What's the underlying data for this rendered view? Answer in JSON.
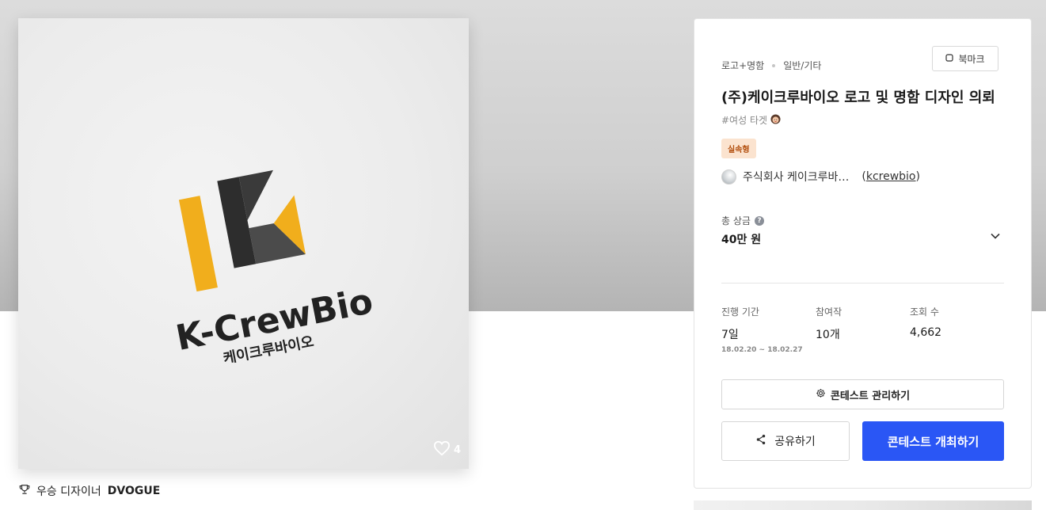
{
  "artwork": {
    "brand_name": "K-CrewBio",
    "brand_name_ko": "케이크루바이오",
    "like_count": "4",
    "colors": {
      "yellow": "#f1ae1c",
      "dark": "#2d2d2d",
      "gray": "#5a5a5a"
    }
  },
  "winner": {
    "label": "우승 디자이너",
    "name": "DVOGUE"
  },
  "contest": {
    "category": "로고+명함",
    "subcategory": "일반/기타",
    "bookmark_label": "북마크",
    "title": "(주)케이크루바이오 로고 및 명함 디자인 의뢰",
    "tag": "#여성 타겟",
    "type_badge": "실속형",
    "host_name": "주식회사 케이크루바…",
    "host_id_open": "(",
    "host_id": "kcrewbio",
    "host_id_close": ")",
    "prize_label": "총 상금",
    "prize_value": "40만 원",
    "stats": {
      "period_label": "진행 기간",
      "period_value": "7일",
      "period_range": "18.02.20 ~ 18.02.27",
      "entries_label": "참여작",
      "entries_value": "10개",
      "views_label": "조회 수",
      "views_value": "4,662"
    },
    "manage_label": "콘테스트 관리하기",
    "share_label": "공유하기",
    "host_contest_label": "콘테스트 개최하기"
  },
  "colors": {
    "primary_button": "#2a56f5",
    "badge_bg": "#fbe3cf",
    "badge_text": "#b24f0e"
  }
}
